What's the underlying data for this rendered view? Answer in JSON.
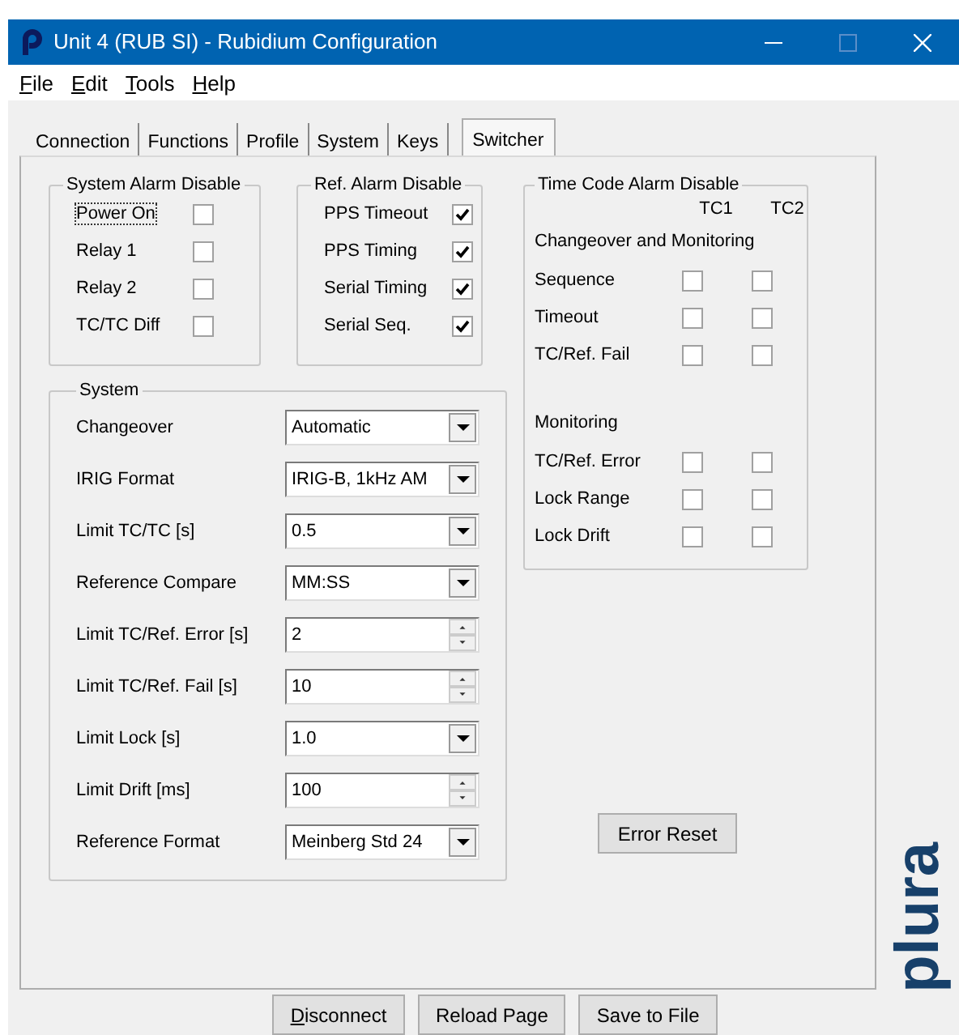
{
  "window": {
    "title": "Unit 4 (RUB SI) - Rubidium Configuration"
  },
  "menu": [
    "File",
    "Edit",
    "Tools",
    "Help"
  ],
  "tabs": [
    {
      "label": "Connection",
      "selected": false
    },
    {
      "label": "Functions",
      "selected": false
    },
    {
      "label": "Profile",
      "selected": false
    },
    {
      "label": "System",
      "selected": false
    },
    {
      "label": "Keys",
      "selected": false
    },
    {
      "label": "Switcher",
      "selected": true
    }
  ],
  "system_alarm_disable": {
    "title": "System Alarm Disable",
    "items": [
      {
        "label": "Power On",
        "checked": false,
        "focused": true
      },
      {
        "label": "Relay 1",
        "checked": false,
        "focused": false
      },
      {
        "label": "Relay 2",
        "checked": false,
        "focused": false
      },
      {
        "label": "TC/TC Diff",
        "checked": false,
        "focused": false
      }
    ]
  },
  "ref_alarm_disable": {
    "title": "Ref. Alarm Disable",
    "items": [
      {
        "label": "PPS Timeout",
        "checked": true,
        "focused": false
      },
      {
        "label": "PPS Timing",
        "checked": true,
        "focused": false
      },
      {
        "label": "Serial Timing",
        "checked": true,
        "focused": false
      },
      {
        "label": "Serial Seq.",
        "checked": true,
        "focused": false
      }
    ]
  },
  "system": {
    "title": "System",
    "fields": [
      {
        "label": "Changeover",
        "kind": "dropdown",
        "value": "Automatic"
      },
      {
        "label": "IRIG Format",
        "kind": "dropdown",
        "value": "IRIG-B, 1kHz AM"
      },
      {
        "label": "Limit TC/TC [s]",
        "kind": "dropdown",
        "value": "0.5"
      },
      {
        "label": "Reference Compare",
        "kind": "dropdown",
        "value": "MM:SS"
      },
      {
        "label": "Limit TC/Ref. Error [s]",
        "kind": "spinner",
        "value": "2"
      },
      {
        "label": "Limit TC/Ref. Fail [s]",
        "kind": "spinner",
        "value": "10"
      },
      {
        "label": "Limit Lock [s]",
        "kind": "dropdown",
        "value": "1.0"
      },
      {
        "label": "Limit Drift [ms]",
        "kind": "spinner",
        "value": "100"
      },
      {
        "label": "Reference Format",
        "kind": "dropdown",
        "value": "Meinberg Std 24"
      }
    ]
  },
  "time_code_alarm_disable": {
    "title": "Time Code Alarm Disable",
    "columns": [
      "TC1",
      "TC2"
    ],
    "sections": [
      {
        "heading": "Changeover and Monitoring",
        "rows": [
          {
            "label": "Sequence",
            "tc1_checked": false,
            "tc2_checked": false
          },
          {
            "label": "Timeout",
            "tc1_checked": false,
            "tc2_checked": false
          },
          {
            "label": "TC/Ref. Fail",
            "tc1_checked": false,
            "tc2_checked": false
          }
        ]
      },
      {
        "heading": "Monitoring",
        "rows": [
          {
            "label": "TC/Ref. Error",
            "tc1_checked": false,
            "tc2_checked": false
          },
          {
            "label": "Lock Range",
            "tc1_checked": false,
            "tc2_checked": false
          },
          {
            "label": "Lock Drift",
            "tc1_checked": false,
            "tc2_checked": false
          }
        ]
      }
    ]
  },
  "error_reset_button": "Error Reset",
  "logo_text": "plura",
  "buttons": [
    "Disconnect",
    "Reload Page",
    "Save to File"
  ]
}
